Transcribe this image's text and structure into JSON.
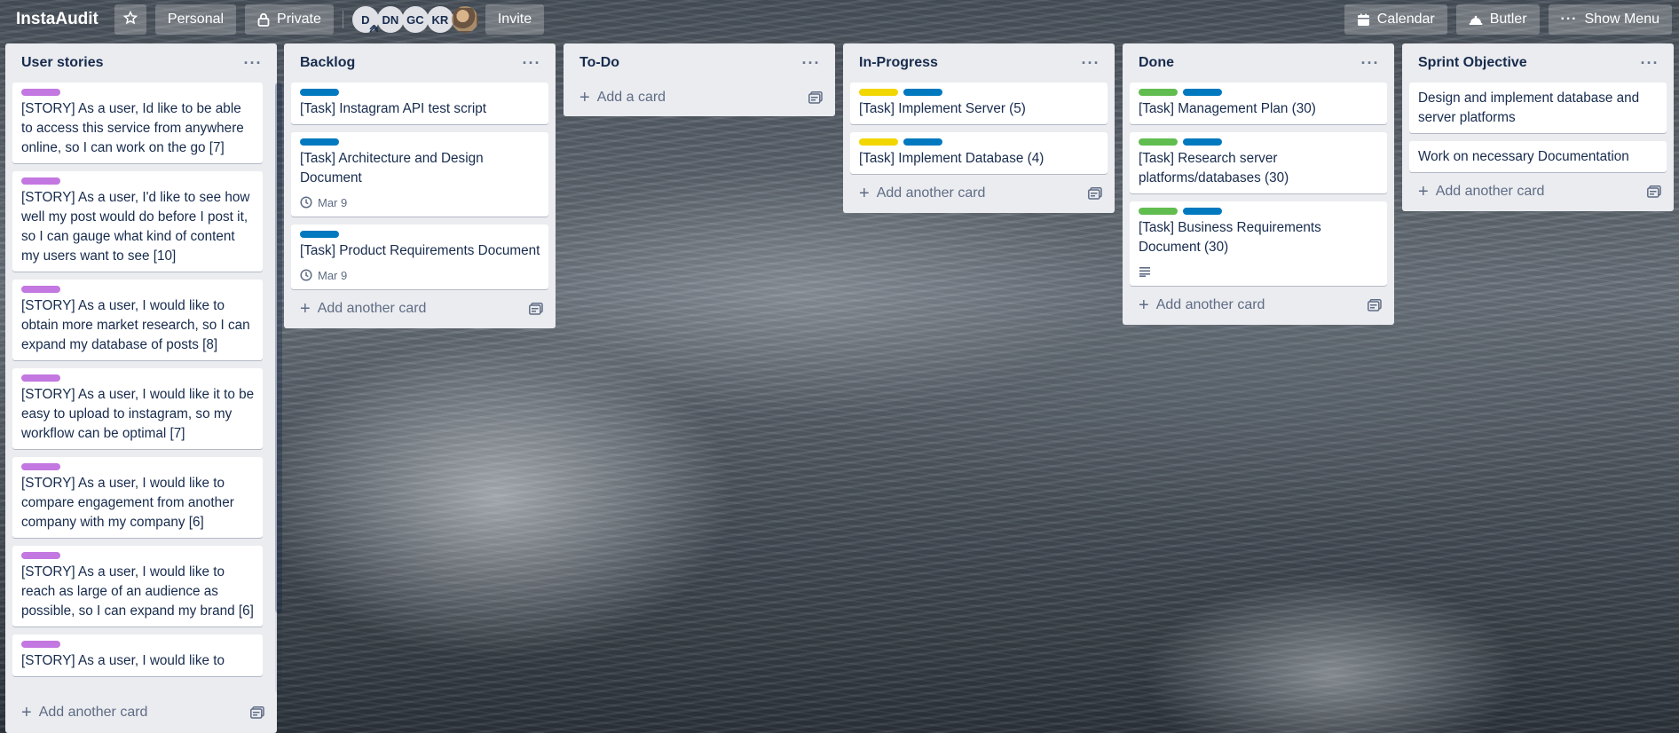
{
  "header": {
    "title": "InstaAudit",
    "star_icon": "star-icon",
    "personal_label": "Personal",
    "private_label": "Private",
    "members": [
      "D",
      "DN",
      "GC",
      "KR"
    ],
    "invite_label": "Invite",
    "calendar_label": "Calendar",
    "butler_label": "Butler",
    "show_menu_label": "Show Menu"
  },
  "colors": {
    "purple": "#c377e0",
    "blue": "#0079bf",
    "yellow": "#f2d600",
    "green": "#61bd4f"
  },
  "lists": {
    "user_stories": {
      "title": "User stories",
      "cards": [
        "[STORY] As a user, Id like to be able to access this service from anywhere online, so I can work on the go [7]",
        "[STORY] As a user, I'd like to see how well my post would do before I post it, so I can gauge what kind of content my users want to see [10]",
        "[STORY] As a user, I would like to obtain more market research, so I can expand my database of posts [8]",
        "[STORY] As a user, I would like it to be easy to upload to instagram, so my workflow can be optimal [7]",
        "[STORY] As a user, I would like to compare engagement from another company with my company [6]",
        "[STORY] As a user, I would like to reach as large of an audience as possible, so I can expand my brand [6]",
        "[STORY] As a user, I would like to"
      ],
      "add_label": "Add another card"
    },
    "backlog": {
      "title": "Backlog",
      "cards": [
        {
          "title": "[Task] Instagram API test script"
        },
        {
          "title": "[Task] Architecture and Design Document",
          "due": "Mar 9"
        },
        {
          "title": "[Task] Product Requirements Document",
          "due": "Mar 9"
        }
      ],
      "add_label": "Add another card"
    },
    "todo": {
      "title": "To-Do",
      "add_label": "Add a card"
    },
    "in_progress": {
      "title": "In-Progress",
      "cards": [
        {
          "title": "[Task] Implement Server (5)"
        },
        {
          "title": "[Task] Implement Database (4)"
        }
      ],
      "add_label": "Add another card"
    },
    "done": {
      "title": "Done",
      "cards": [
        {
          "title": "[Task] Management Plan (30)"
        },
        {
          "title": "[Task] Research server platforms/databases (30)"
        },
        {
          "title": "[Task] Business Requirements Document (30)"
        }
      ],
      "add_label": "Add another card"
    },
    "sprint_objective": {
      "title": "Sprint Objective",
      "cards": [
        "Design and implement database and server platforms",
        "Work on necessary Documentation"
      ],
      "add_label": "Add another card"
    }
  }
}
